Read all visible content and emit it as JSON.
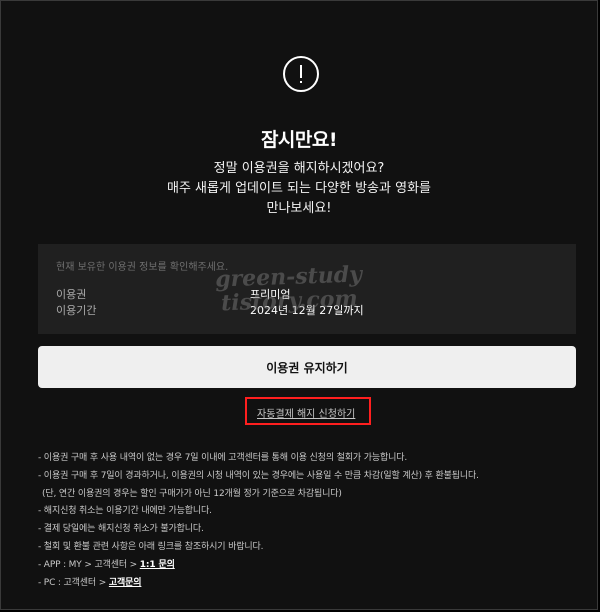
{
  "dialog": {
    "title": "잠시만요!",
    "subtitle_lines": [
      "정말 이용권을 해지하시겠어요?",
      "매주 새롭게 업데이트 되는 다양한 방송과 영화를",
      "만나보세요!"
    ]
  },
  "info_box": {
    "heading": "현재 보유한 이용권 정보를 확인해주세요.",
    "ticket_label": "이용권",
    "ticket_value": "프리미엄",
    "period_label": "이용기간",
    "period_value": "2024년 12월 27일까지"
  },
  "watermark": {
    "line1": "green-study",
    "line2": "tistory.com"
  },
  "buttons": {
    "keep_label": "이용권 유지하기",
    "cancel_auto_pay_label": "자동결제 해지 신청하기"
  },
  "notes": {
    "line1": "- 이용권 구매 후 사용 내역이 없는 경우 7일 이내에 고객센터를 통해 이용 신청의 철회가 가능합니다.",
    "line2": "- 이용권 구매 후 7일이 경과하거나, 이용권의 시청 내역이 있는 경우에는 사용일 수 만큼 차감(일할 계산) 후 환불됩니다.",
    "line3": "(단, 연간 이용권의 경우는 할인 구매가가 아닌 12개월 정가 기준으로 차감됩니다)",
    "line4": "- 해지신청 취소는 이용기간 내에만 가능합니다.",
    "line5": "- 결제 당일에는 해지신청 취소가 불가합니다.",
    "line6": "- 철회 및 환불 관련 사항은 아래 링크를 참조하시기 바랍니다.",
    "app_prefix": "- APP : MY > 고객센터 > ",
    "app_link": "1:1 문의",
    "pc_prefix": "- PC : 고객센터 > ",
    "pc_link": "고객문의"
  },
  "colors": {
    "background": "#111111",
    "info_box": "#202020",
    "button": "#efefef",
    "highlight": "#ff1f1f"
  }
}
